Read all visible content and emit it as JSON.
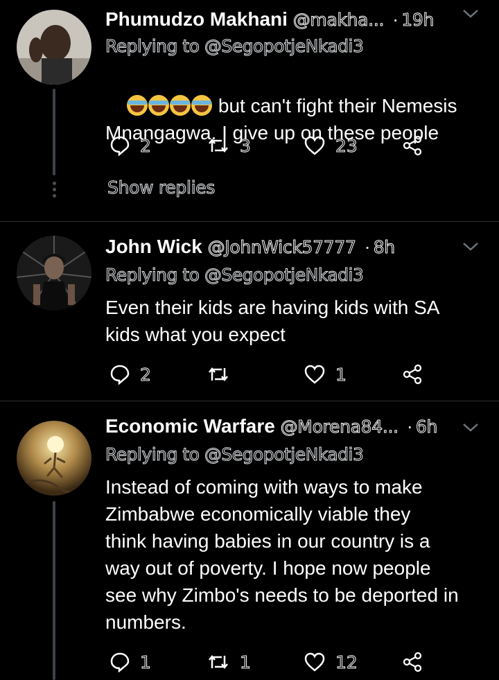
{
  "tweets": [
    {
      "name": "Phumudzo Makhani",
      "handle": "@makha...",
      "time": "19h",
      "replying": "Replying to @SegopotjeNkadi3",
      "body_line1": "but can't fight their Nemesis",
      "body_line2": "Mnangagwa. I give up on these people",
      "replies": "2",
      "retweets": "3",
      "likes": "23",
      "show_replies": "Show replies"
    },
    {
      "name": "John Wick",
      "handle": "@JohnWick57777",
      "time": "8h",
      "replying": "Replying to @SegopotjeNkadi3",
      "body": "Even their kids are having kids with SA\nkids what you expect",
      "replies": "2",
      "retweets": "",
      "likes": "1"
    },
    {
      "name": "Economic Warfare",
      "handle": "@Morena84...",
      "time": "6h",
      "replying": "Replying to @SegopotjeNkadi3",
      "body": "Instead of coming with ways to make\nZimbabwe economically viable they\nthink having babies in our country is a\nway out of poverty. I hope now people\nsee why Zimbo's needs to be deported in\nnumbers.",
      "replies": "1",
      "retweets": "1",
      "likes": "12"
    }
  ],
  "icons": {
    "reply": "reply-icon",
    "retweet": "retweet-icon",
    "like": "heart-icon",
    "share": "share-icon",
    "more": "chevron-down-icon"
  },
  "colors": {
    "background": "#000000",
    "divider": "#2f3336",
    "icon": "#ffffff"
  }
}
